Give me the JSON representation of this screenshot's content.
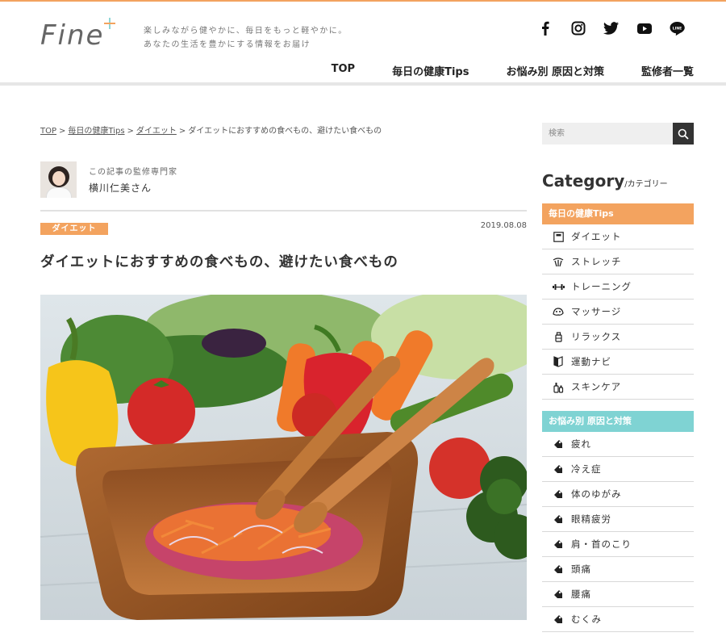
{
  "site": {
    "logo": "Fine",
    "tagline_1": "楽しみながら健やかに、毎日をもっと軽やかに。",
    "tagline_2": "あなたの生活を豊かにする情報をお届け",
    "social": [
      "facebook-icon",
      "instagram-icon",
      "twitter-icon",
      "youtube-icon",
      "line-icon"
    ],
    "nav": [
      "TOP",
      "毎日の健康Tips",
      "お悩み別 原因と対策",
      "監修者一覧"
    ],
    "colors": {
      "accent_orange": "#f3a35f",
      "accent_teal": "#7fd3d3"
    }
  },
  "breadcrumb": {
    "items": [
      "TOP",
      "毎日の健康Tips",
      "ダイエット"
    ],
    "current": "ダイエットにおすすめの食べもの、避けたい食べもの",
    "separator": ">"
  },
  "author": {
    "role": "この記事の監修専門家",
    "name": "横川仁美さん"
  },
  "article": {
    "category": "ダイエット",
    "date": "2019.08.08",
    "title": "ダイエットにおすすめの食べもの、避けたい食べもの"
  },
  "sidebar": {
    "search_placeholder": "検索",
    "category_heading": "Category",
    "category_heading_sub": "/カテゴリー",
    "tips": {
      "title": "毎日の健康Tips",
      "items": [
        {
          "label": "ダイエット",
          "icon": "scale-icon"
        },
        {
          "label": "ストレッチ",
          "icon": "stretch-icon"
        },
        {
          "label": "トレーニング",
          "icon": "dumbbell-icon"
        },
        {
          "label": "マッサージ",
          "icon": "massage-icon"
        },
        {
          "label": "リラックス",
          "icon": "aroma-icon"
        },
        {
          "label": "運動ナビ",
          "icon": "navi-icon"
        },
        {
          "label": "スキンケア",
          "icon": "bottle-icon"
        }
      ]
    },
    "concerns": {
      "title": "お悩み別 原因と対策",
      "items": [
        "疲れ",
        "冷え症",
        "体のゆがみ",
        "眼精疲労",
        "肩・首のこり",
        "頭痛",
        "腰痛",
        "むくみ"
      ]
    }
  }
}
